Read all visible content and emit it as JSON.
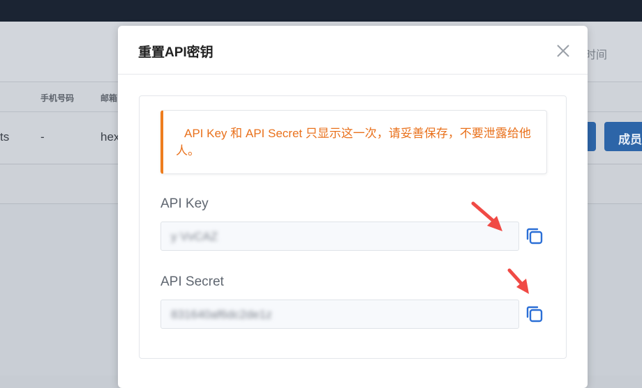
{
  "background": {
    "header_col_time": "时间",
    "table_headers": {
      "phone": "手机号码",
      "email": "邮箱"
    },
    "row": {
      "name_partial": "ts",
      "phone": "-",
      "email_partial": "hex"
    },
    "member_button": "成员"
  },
  "modal": {
    "title": "重置API密钥",
    "close_icon": "close-icon",
    "alert_text": "API Key 和 API Secret 只显示这一次，请妥善保存，不要泄露给他人。",
    "api_key": {
      "label": "API Key",
      "value": "y      VvCAZ"
    },
    "api_secret": {
      "label": "API Secret",
      "value": "            831640af6dc2de1z                       "
    },
    "copy_icon": "copy-icon"
  },
  "colors": {
    "accent_orange": "#ee7d1e",
    "copy_blue": "#2b6fd6",
    "arrow_red": "#f04a45",
    "topbar": "#1b2433"
  }
}
